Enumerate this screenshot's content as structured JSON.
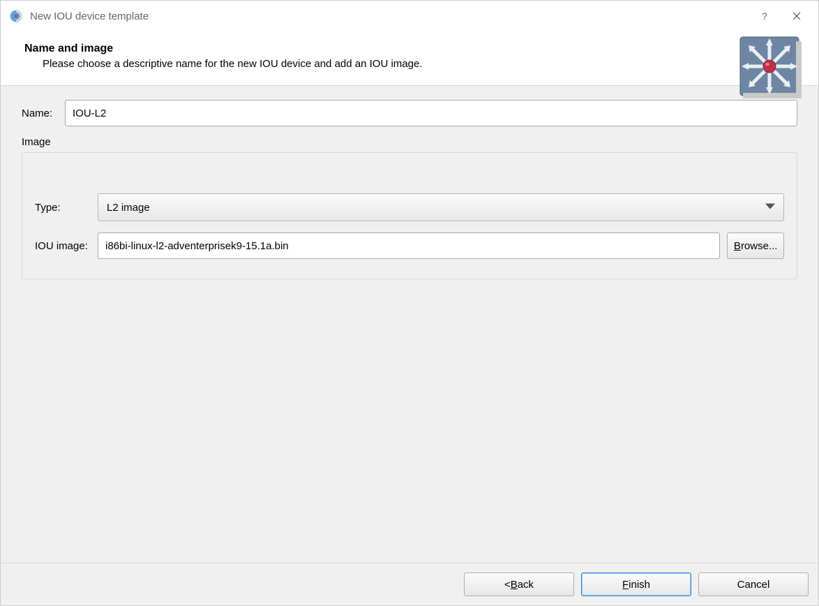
{
  "titlebar": {
    "title": "New IOU device template"
  },
  "header": {
    "title": "Name and image",
    "description": "Please choose a descriptive name for the new IOU device and add an IOU image."
  },
  "form": {
    "name_label": "Name:",
    "name_value": "IOU-L2",
    "image_group_label": "Image",
    "type_label": "Type:",
    "type_value": "L2 image",
    "iou_image_label": "IOU image:",
    "iou_image_value": "i86bi-linux-l2-adventerprisek9-15.1a.bin",
    "browse_pre": "",
    "browse_mn": "B",
    "browse_post": "rowse..."
  },
  "buttons": {
    "back_pre": "< ",
    "back_mn": "B",
    "back_post": "ack",
    "finish_pre": "",
    "finish_mn": "F",
    "finish_post": "inish",
    "cancel": "Cancel"
  }
}
